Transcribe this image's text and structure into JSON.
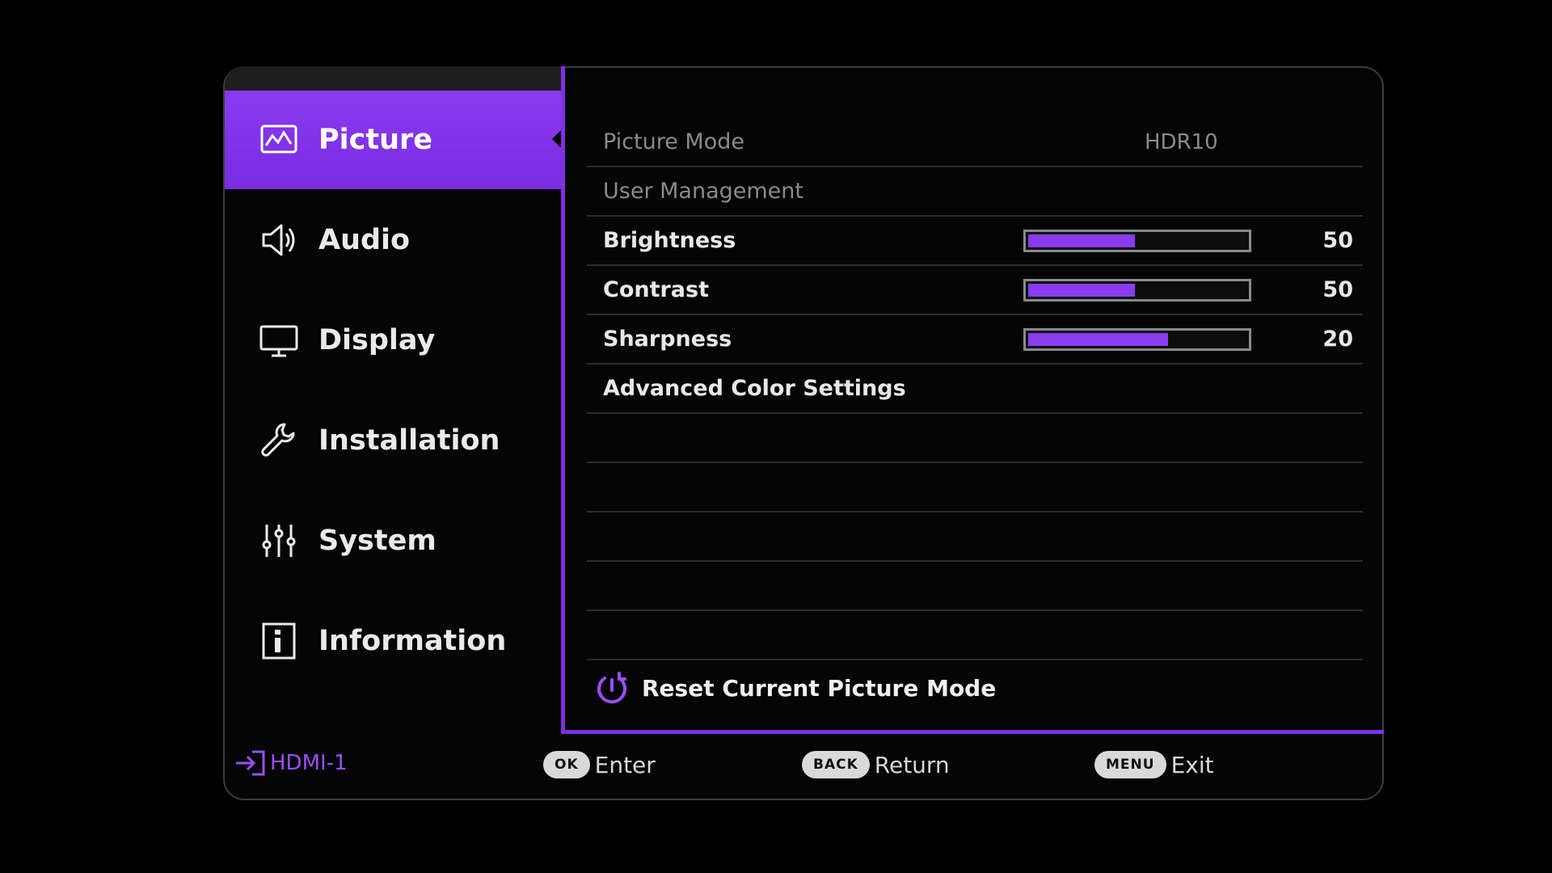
{
  "sidebar": {
    "items": [
      {
        "label": "Picture",
        "icon": "picture-icon",
        "active": true
      },
      {
        "label": "Audio",
        "icon": "speaker-icon",
        "active": false
      },
      {
        "label": "Display",
        "icon": "monitor-icon",
        "active": false
      },
      {
        "label": "Installation",
        "icon": "wrench-icon",
        "active": false
      },
      {
        "label": "System",
        "icon": "sliders-icon",
        "active": false
      },
      {
        "label": "Information",
        "icon": "info-icon",
        "active": false
      }
    ]
  },
  "picture_menu": {
    "picture_mode": {
      "label": "Picture Mode",
      "value": "HDR10"
    },
    "user_management": {
      "label": "User Management"
    },
    "brightness": {
      "label": "Brightness",
      "value": "50",
      "level": 0.5
    },
    "contrast": {
      "label": "Contrast",
      "value": "50",
      "level": 0.5
    },
    "sharpness": {
      "label": "Sharpness",
      "value": "20",
      "level": 0.65
    },
    "advanced_color": {
      "label": "Advanced Color Settings"
    },
    "reset": {
      "label": "Reset Current Picture Mode"
    }
  },
  "footer": {
    "source": "HDMI-1",
    "ok_key": "OK",
    "ok_label": "Enter",
    "back_key": "BACK",
    "back_label": "Return",
    "menu_key": "MENU",
    "menu_label": "Exit"
  },
  "colors": {
    "accent": "#8b3bf0",
    "background": "#000000",
    "text": "#e8e8e8",
    "dim_text": "#8a8a8a"
  }
}
